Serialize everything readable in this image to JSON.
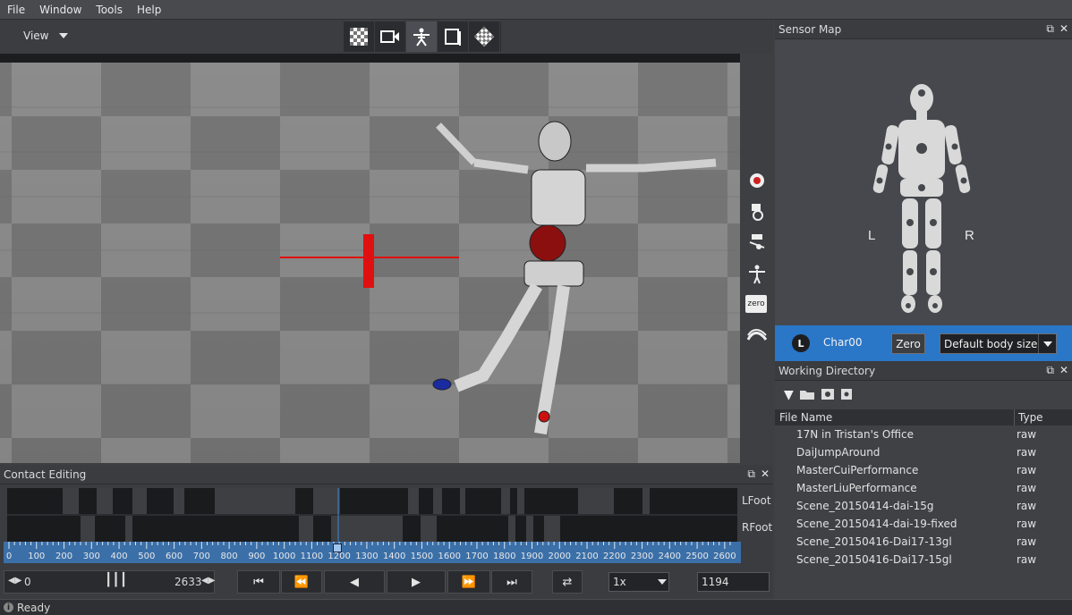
{
  "menu": [
    "File",
    "Window",
    "Tools",
    "Help"
  ],
  "toolbar": {
    "view_label": "View"
  },
  "viewport_side": {
    "zero_label": "zero"
  },
  "sensor_map": {
    "title": "Sensor Map",
    "left_label": "L",
    "right_label": "R"
  },
  "character": {
    "badge": "L",
    "name": "Char00",
    "zero_label": "Zero",
    "body_size": "Default body size"
  },
  "working_directory": {
    "title": "Working Directory",
    "columns": [
      "File Name",
      "Type"
    ],
    "files": [
      {
        "name": "17N in Tristan's Office",
        "type": "raw"
      },
      {
        "name": "DaiJumpAround",
        "type": "raw"
      },
      {
        "name": "MasterCuiPerformance",
        "type": "raw"
      },
      {
        "name": "MasterLiuPerformance",
        "type": "raw"
      },
      {
        "name": "Scene_20150414-dai-15g",
        "type": "raw"
      },
      {
        "name": "Scene_20150414-dai-19-fixed",
        "type": "raw"
      },
      {
        "name": "Scene_20150416-Dai17-13gl",
        "type": "raw"
      },
      {
        "name": "Scene_20150416-Dai17-15gl",
        "type": "raw"
      }
    ]
  },
  "contact_editing": {
    "title": "Contact Editing",
    "tracks": [
      "LFoot",
      "RFoot"
    ],
    "ruler_ticks": [
      "0",
      "100",
      "200",
      "300",
      "400",
      "500",
      "600",
      "700",
      "800",
      "900",
      "1000",
      "1100",
      "1200",
      "1300",
      "1400",
      "1500",
      "1600",
      "1700",
      "1800",
      "1900",
      "2000",
      "2100",
      "2200",
      "2300",
      "2400",
      "2500",
      "2600"
    ],
    "range_start": "0",
    "range_end": "2633",
    "speed": "1x",
    "current_frame": "1194"
  },
  "status": {
    "text": "Ready"
  },
  "colors": {
    "accent": "#2a76c7",
    "ruler": "#3b6fa8",
    "contact_marker": "#cc1111"
  }
}
